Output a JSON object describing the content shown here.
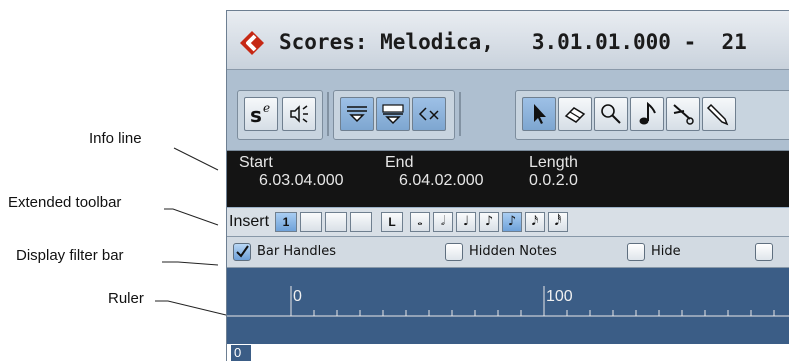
{
  "callouts": {
    "info_line": "Info line",
    "extended_toolbar": "Extended toolbar",
    "display_filter_bar": "Display filter bar",
    "ruler": "Ruler"
  },
  "window": {
    "title": "Scores: Melodica,   3.01.01.000 -  21",
    "icon": "cubase-logo-icon"
  },
  "toolbar": {
    "buttons": [
      {
        "icon": "solo-edit-icon",
        "label": "s"
      },
      {
        "icon": "speaker-icon"
      },
      {
        "icon": "step-input-icon"
      },
      {
        "icon": "move-insert-icon"
      },
      {
        "icon": "connect-icon"
      },
      {
        "icon": "arrow-pointer-icon"
      },
      {
        "icon": "eraser-icon"
      },
      {
        "icon": "zoom-icon"
      },
      {
        "icon": "note-icon"
      },
      {
        "icon": "scissors-icon"
      },
      {
        "icon": "pencil-icon"
      }
    ]
  },
  "info_line": {
    "start_label": "Start",
    "start_value": "6.03.04.000",
    "end_label": "End",
    "end_value": "6.04.02.000",
    "length_label": "Length",
    "length_value": "0.0.2.0"
  },
  "extended_toolbar": {
    "insert_label": "Insert",
    "voice_buttons": [
      "1",
      "",
      "",
      ""
    ],
    "l_button": "L",
    "note_values": [
      "𝅝",
      "𝅗𝅥",
      "♩",
      "♪",
      "♪",
      "𝅘𝅥𝅯",
      "𝅘𝅥𝅰"
    ],
    "active_note_index": 4
  },
  "display_filter_bar": {
    "items": [
      {
        "label": "Bar Handles",
        "checked": true
      },
      {
        "label": "Hidden Notes",
        "checked": false
      },
      {
        "label": "Hide",
        "checked": false
      },
      {
        "label": "",
        "checked": false
      }
    ]
  },
  "ruler": {
    "labels": [
      "0",
      "100"
    ],
    "bar_marker": "0"
  }
}
